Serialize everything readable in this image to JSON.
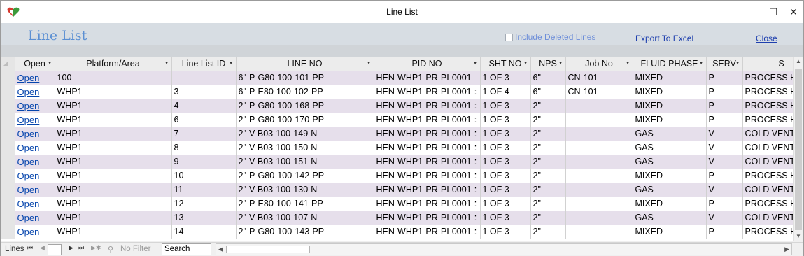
{
  "window": {
    "title": "Line List",
    "minimize_glyph": "—",
    "maximize_glyph": "☐",
    "close_glyph": "✕",
    "icon": "app-heart-icon"
  },
  "header": {
    "form_title": "Line List",
    "include_deleted_label": "Include Deleted Lines",
    "export_label": "Export To Excel",
    "close_label": "Close"
  },
  "grid": {
    "columns": [
      {
        "label": "Open",
        "sortable": true
      },
      {
        "label": "Platform/Area",
        "sortable": true
      },
      {
        "label": "Line List ID",
        "sortable": true
      },
      {
        "label": "LINE NO",
        "sortable": true
      },
      {
        "label": "PID NO",
        "sortable": true
      },
      {
        "label": "SHT NO",
        "sortable": true
      },
      {
        "label": "NPS",
        "sortable": true
      },
      {
        "label": "Job No",
        "sortable": true
      },
      {
        "label": "FLUID PHASE",
        "sortable": true
      },
      {
        "label": "SERV",
        "sortable": true
      },
      {
        "label": "S",
        "sortable": false
      }
    ],
    "rows": [
      [
        "Open",
        "100",
        "",
        "6\"-P-G80-100-101-PP",
        "HEN-WHP1-PR-PI-0001",
        "1 OF 3",
        "6\"",
        "CN-101",
        "MIXED",
        "P",
        "PROCESS HY"
      ],
      [
        "Open",
        "WHP1",
        "3",
        "6\"-P-E80-100-102-PP",
        "HEN-WHP1-PR-PI-0001-:",
        "1 OF 4",
        "6\"",
        "CN-101",
        "MIXED",
        "P",
        "PROCESS HY"
      ],
      [
        "Open",
        "WHP1",
        "4",
        "2\"-P-G80-100-168-PP",
        "HEN-WHP1-PR-PI-0001-:",
        "1 OF 3",
        "2\"",
        "",
        "MIXED",
        "P",
        "PROCESS HY"
      ],
      [
        "Open",
        "WHP1",
        "6",
        "2\"-P-G80-100-170-PP",
        "HEN-WHP1-PR-PI-0001-:",
        "1 OF 3",
        "2\"",
        "",
        "MIXED",
        "P",
        "PROCESS HY"
      ],
      [
        "Open",
        "WHP1",
        "7",
        "2\"-V-B03-100-149-N",
        "HEN-WHP1-PR-PI-0001-:",
        "1 OF 3",
        "2\"",
        "",
        "GAS",
        "V",
        "COLD VENT"
      ],
      [
        "Open",
        "WHP1",
        "8",
        "2\"-V-B03-100-150-N",
        "HEN-WHP1-PR-PI-0001-:",
        "1 OF 3",
        "2\"",
        "",
        "GAS",
        "V",
        "COLD VENT"
      ],
      [
        "Open",
        "WHP1",
        "9",
        "2\"-V-B03-100-151-N",
        "HEN-WHP1-PR-PI-0001-:",
        "1 OF 3",
        "2\"",
        "",
        "GAS",
        "V",
        "COLD VENT"
      ],
      [
        "Open",
        "WHP1",
        "10",
        "2\"-P-G80-100-142-PP",
        "HEN-WHP1-PR-PI-0001-:",
        "1 OF 3",
        "2\"",
        "",
        "MIXED",
        "P",
        "PROCESS HY"
      ],
      [
        "Open",
        "WHP1",
        "11",
        "2\"-V-B03-100-130-N",
        "HEN-WHP1-PR-PI-0001-:",
        "1 OF 3",
        "2\"",
        "",
        "GAS",
        "V",
        "COLD VENT"
      ],
      [
        "Open",
        "WHP1",
        "12",
        "2\"-P-E80-100-141-PP",
        "HEN-WHP1-PR-PI-0001-:",
        "1 OF 3",
        "2\"",
        "",
        "MIXED",
        "P",
        "PROCESS HY"
      ],
      [
        "Open",
        "WHP1",
        "13",
        "2\"-V-B03-100-107-N",
        "HEN-WHP1-PR-PI-0001-:",
        "1 OF 3",
        "2\"",
        "",
        "GAS",
        "V",
        "COLD VENT"
      ],
      [
        "Open",
        "WHP1",
        "14",
        "2\"-P-G80-100-143-PP",
        "HEN-WHP1-PR-PI-0001-:",
        "1 OF 3",
        "2\"",
        "",
        "MIXED",
        "P",
        "PROCESS HY"
      ]
    ]
  },
  "navigation": {
    "label": "Lines",
    "first_glyph": "⏮",
    "prev_glyph": "◀",
    "next_glyph": "▶",
    "last_glyph": "⏭",
    "new_glyph": "▶✱",
    "filter_label": "No Filter",
    "search_placeholder": "Search"
  }
}
